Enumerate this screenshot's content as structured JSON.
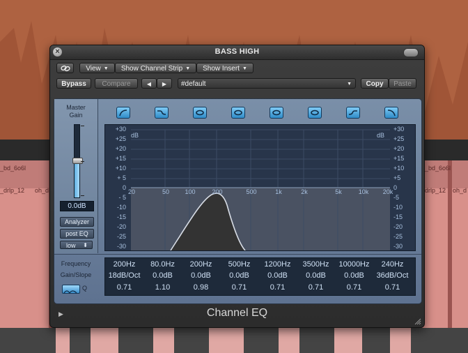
{
  "window": {
    "title": "BASS HIGH",
    "close_glyph": "×"
  },
  "background": {
    "region_labels": [
      "_bd_6o6l",
      "_bd_6o6l",
      "_drlp_12",
      "oh_d",
      "drlp_12",
      "oh_d"
    ]
  },
  "toolbar": {
    "link_icon": "link-icon",
    "view_label": "View",
    "channel_strip_label": "Show Channel Strip",
    "insert_label": "Show Insert",
    "bypass_label": "Bypass",
    "compare_label": "Compare",
    "prev_glyph": "◀",
    "next_glyph": "▶",
    "preset_name": "#default",
    "copy_label": "Copy",
    "paste_label": "Paste"
  },
  "left": {
    "master_gain_line1": "Master",
    "master_gain_line2": "Gain",
    "master_gain_value": "0.0dB",
    "analyzer_label": "Analyzer",
    "post_eq_label": "post EQ",
    "resolution_label": "low",
    "resolution_arrow": "⬍"
  },
  "graph": {
    "db_label_left": "dB",
    "db_label_right": "dB",
    "db_ticks": [
      "+30",
      "+25",
      "+20",
      "+15",
      "+10",
      "+ 5",
      "0",
      "- 5",
      "-10",
      "-15",
      "-20",
      "-25",
      "-30"
    ],
    "db_ticks_right": [
      "+30",
      "+25",
      "+20",
      "+15",
      "+10",
      "+5",
      "0",
      "-5",
      "-10",
      "-15",
      "-20",
      "-25",
      "-30"
    ],
    "freq_ticks": [
      "20",
      "50",
      "100",
      "200",
      "500",
      "1k",
      "2k",
      "5k",
      "10k",
      "20k"
    ]
  },
  "bands": {
    "row_frequency_label": "Frequency",
    "row_gain_label": "Gain/Slope",
    "q_label": "Q",
    "icons": [
      "low-cut-icon",
      "low-shelf-icon",
      "peak-icon",
      "peak-icon",
      "peak-icon",
      "peak-icon",
      "high-shelf-icon",
      "high-cut-icon"
    ],
    "frequency": [
      "200Hz",
      "80.0Hz",
      "200Hz",
      "500Hz",
      "1200Hz",
      "3500Hz",
      "10000Hz",
      "240Hz"
    ],
    "gain": [
      "18dB/Oct",
      "0.0dB",
      "0.0dB",
      "0.0dB",
      "0.0dB",
      "0.0dB",
      "0.0dB",
      "36dB/Oct"
    ],
    "q": [
      "0.71",
      "1.10",
      "0.98",
      "0.71",
      "0.71",
      "0.71",
      "0.71",
      "0.71"
    ]
  },
  "footer": {
    "plugin_name": "Channel EQ",
    "disclosure_glyph": "▶"
  },
  "colors": {
    "eq_accent": "#5fb0e0",
    "panel": "#6e839e",
    "curve_fill": "#3a3a3a"
  }
}
